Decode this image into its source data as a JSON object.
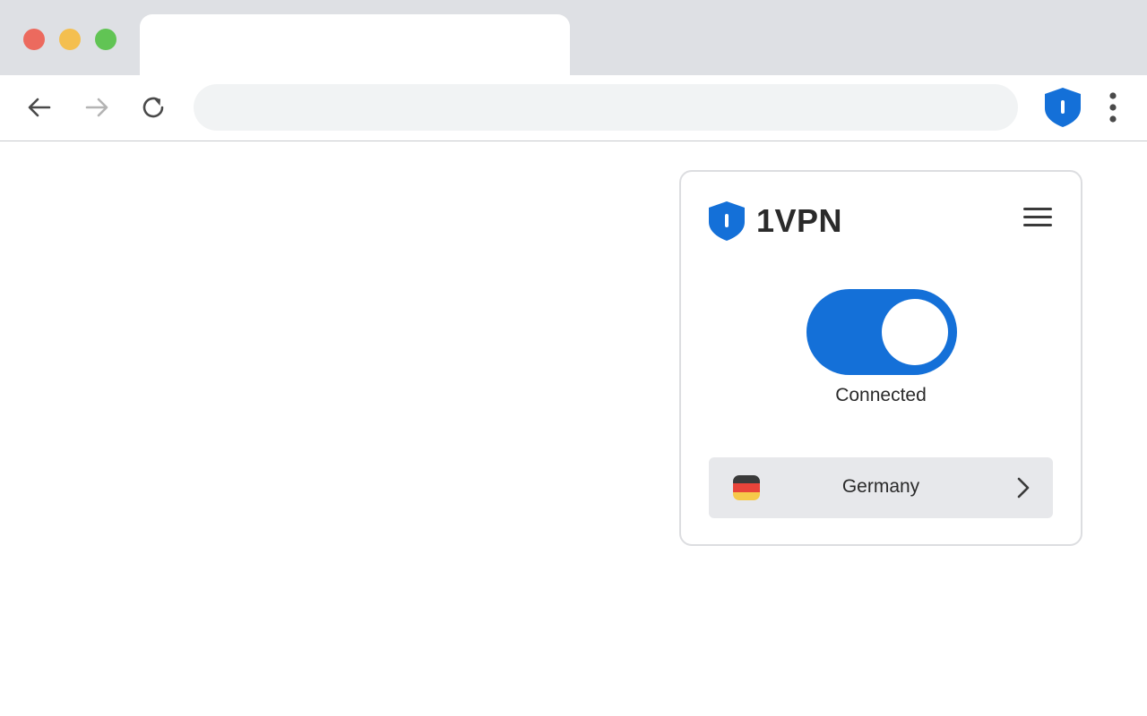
{
  "browser": {
    "tab_title": "",
    "address_value": "",
    "address_placeholder": ""
  },
  "extension": {
    "brand": "1VPN",
    "status": "Connected",
    "connected": true,
    "location": {
      "country": "Germany",
      "flag_colors": [
        "#3a3a3a",
        "#e8443a",
        "#f6c94a"
      ]
    },
    "icons": {
      "logo": "shield-icon",
      "menu": "hamburger-menu-icon",
      "chevron": "chevron-right-icon"
    }
  },
  "colors": {
    "accent": "#1470d8",
    "card_bg": "#e7e8eb",
    "chrome_bg": "#dee0e4",
    "omnibox_bg": "#f1f3f4"
  }
}
